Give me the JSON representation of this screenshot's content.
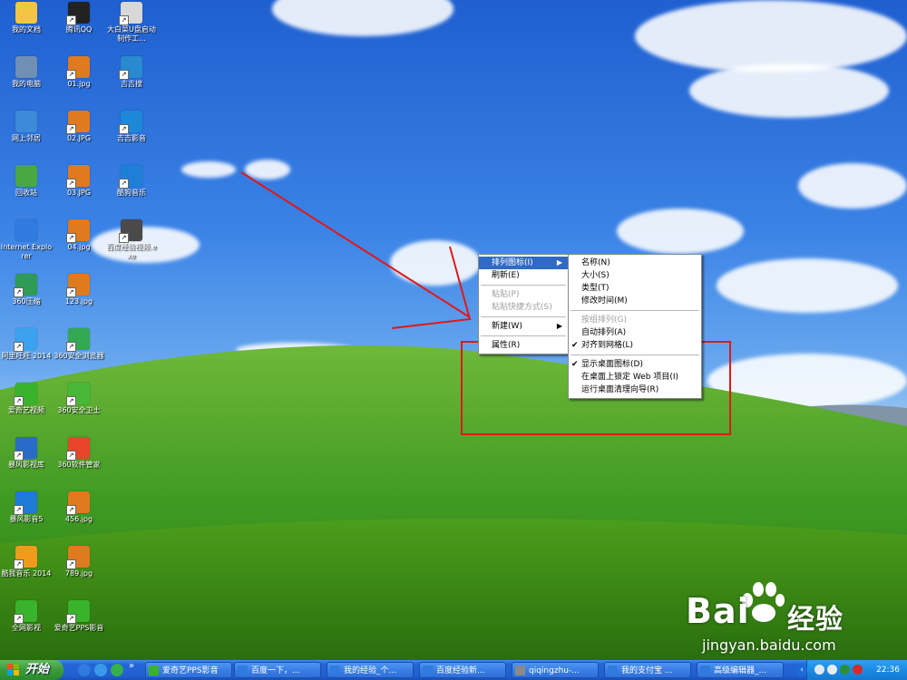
{
  "desktop_icons": [
    {
      "label": "我的文档",
      "icon": "my-documents-icon",
      "color": "#f4c542",
      "shortcut": false
    },
    {
      "label": "我的电脑",
      "icon": "my-computer-icon",
      "color": "#6f8fb5",
      "shortcut": false
    },
    {
      "label": "网上邻居",
      "icon": "network-places-icon",
      "color": "#3c8ad8",
      "shortcut": false
    },
    {
      "label": "回收站",
      "icon": "recycle-bin-icon",
      "color": "#49a842",
      "shortcut": false
    },
    {
      "label": "Internet Explorer",
      "icon": "internet-explorer-icon",
      "color": "#2f7be0",
      "shortcut": false
    },
    {
      "label": "360压缩",
      "icon": "360-zip-icon",
      "color": "#2f9b55",
      "shortcut": true
    },
    {
      "label": "阿里旺旺 2014",
      "icon": "aliwangwang-icon",
      "color": "#3aa2ee",
      "shortcut": true
    },
    {
      "label": "爱奇艺视频",
      "icon": "iqiyi-icon",
      "color": "#38b32b",
      "shortcut": true
    },
    {
      "label": "暴风影视库",
      "icon": "baofeng-library-icon",
      "color": "#2a6ac8",
      "shortcut": true
    },
    {
      "label": "暴风影音5",
      "icon": "baofeng-player-icon",
      "color": "#1f79d6",
      "shortcut": true
    },
    {
      "label": "酷我音乐 2014",
      "icon": "kuwo-music-icon",
      "color": "#f29a1c",
      "shortcut": true
    },
    {
      "label": "全网影视",
      "icon": "quanwang-video-icon",
      "color": "#38b32b",
      "shortcut": true
    },
    {
      "label": "腾讯QQ",
      "icon": "qq-penguin-icon",
      "color": "#222222",
      "shortcut": true
    },
    {
      "label": "01.jpg",
      "icon": "jpg-file-icon",
      "color": "#e07a1f",
      "shortcut": true
    },
    {
      "label": "02.JPG",
      "icon": "jpg-file-icon",
      "color": "#e07a1f",
      "shortcut": true
    },
    {
      "label": "03.JPG",
      "icon": "jpg-file-icon",
      "color": "#e07a1f",
      "shortcut": true
    },
    {
      "label": "04.jpg",
      "icon": "jpg-file-icon",
      "color": "#e07a1f",
      "shortcut": true
    },
    {
      "label": "123.jpg",
      "icon": "jpg-file-icon",
      "color": "#e07a1f",
      "shortcut": true
    },
    {
      "label": "360安全浏览器",
      "icon": "360-browser-icon",
      "color": "#32a852",
      "shortcut": true
    },
    {
      "label": "360安全卫士",
      "icon": "360-safe-icon",
      "color": "#48b838",
      "shortcut": true
    },
    {
      "label": "360软件管家",
      "icon": "360-software-icon",
      "color": "#e8452c",
      "shortcut": true
    },
    {
      "label": "456.jpg",
      "icon": "jpg-file-icon",
      "color": "#e07a1f",
      "shortcut": true
    },
    {
      "label": "789.jpg",
      "icon": "jpg-file-icon",
      "color": "#e07a1f",
      "shortcut": true
    },
    {
      "label": "爱奇艺PPS影音",
      "icon": "iqiyi-pps-icon",
      "color": "#38b32b",
      "shortcut": true
    },
    {
      "label": "大白菜U盘启动制作工...",
      "icon": "window-app-icon",
      "color": "#d8d8d8",
      "shortcut": true
    },
    {
      "label": "吉吉搜",
      "icon": "jijisou-icon",
      "color": "#2a8ad0",
      "shortcut": true
    },
    {
      "label": "吉吉影音",
      "icon": "jiji-player-icon",
      "color": "#1e88d8",
      "shortcut": true
    },
    {
      "label": "酷狗音乐",
      "icon": "kugou-music-icon",
      "color": "#1e7fd8",
      "shortcut": true
    },
    {
      "label": "百度经验视频.exe",
      "icon": "video-camera-icon",
      "color": "#4a4a4a",
      "shortcut": true
    }
  ],
  "context_menu": {
    "items": [
      {
        "label": "排列图标(I)",
        "state": "selected",
        "submenu": true
      },
      {
        "label": "刷新(E)",
        "state": "normal",
        "submenu": false
      },
      {
        "sep": true
      },
      {
        "label": "粘贴(P)",
        "state": "disabled",
        "submenu": false
      },
      {
        "label": "粘贴快捷方式(S)",
        "state": "disabled",
        "submenu": false
      },
      {
        "sep": true
      },
      {
        "label": "新建(W)",
        "state": "normal",
        "submenu": true
      },
      {
        "sep": true
      },
      {
        "label": "属性(R)",
        "state": "normal",
        "submenu": false
      }
    ]
  },
  "submenu": {
    "items": [
      {
        "label": "名称(N)",
        "state": "normal",
        "checked": false
      },
      {
        "label": "大小(S)",
        "state": "normal",
        "checked": false
      },
      {
        "label": "类型(T)",
        "state": "normal",
        "checked": false
      },
      {
        "label": "修改时间(M)",
        "state": "normal",
        "checked": false
      },
      {
        "sep": true
      },
      {
        "label": "按组排列(G)",
        "state": "disabled",
        "checked": false
      },
      {
        "label": "自动排列(A)",
        "state": "normal",
        "checked": false
      },
      {
        "label": "对齐到网格(L)",
        "state": "normal",
        "checked": true
      },
      {
        "sep": true
      },
      {
        "label": "显示桌面图标(D)",
        "state": "normal",
        "checked": true
      },
      {
        "label": "在桌面上锁定 Web 项目(I)",
        "state": "normal",
        "checked": false
      },
      {
        "label": "运行桌面清理向导(R)",
        "state": "normal",
        "checked": false
      }
    ]
  },
  "annotation_color": "#e01818",
  "taskbar": {
    "start_label": "开始",
    "tasks": [
      {
        "label": "爱奇艺PPS影音",
        "icon_color": "#38b32b"
      },
      {
        "label": "百度一下，...",
        "icon_color": "#2f7be0"
      },
      {
        "label": "我的经验_个...",
        "icon_color": "#2f7be0"
      },
      {
        "label": "百度经验新...",
        "icon_color": "#2f7be0"
      },
      {
        "label": "qiqingzhu-...",
        "icon_color": "#8a8a8a"
      },
      {
        "label": "我的支付宝 ...",
        "icon_color": "#2f7be0"
      },
      {
        "label": "高级编辑器_...",
        "icon_color": "#2f7be0"
      }
    ],
    "clock": "22:36"
  },
  "watermark": {
    "brand": "Bai",
    "brand_suffix": "经验",
    "site": "jingyan.baidu.com"
  }
}
